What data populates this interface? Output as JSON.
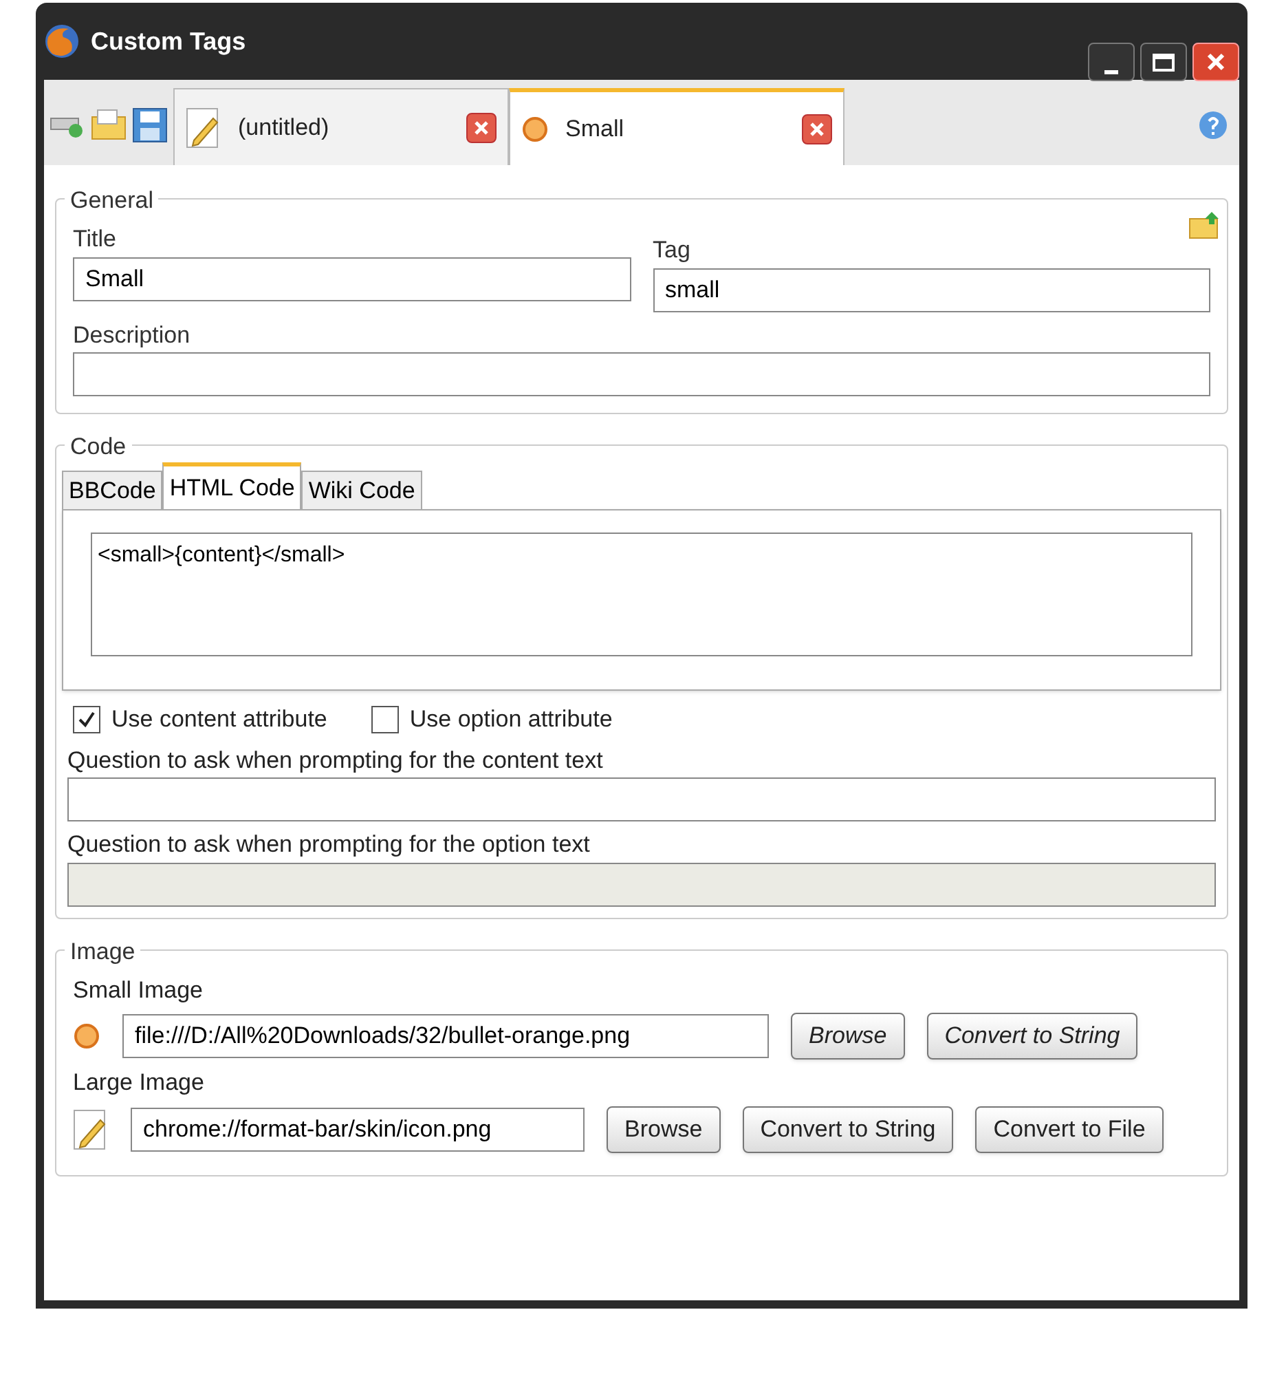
{
  "window": {
    "title": "Custom Tags"
  },
  "doc_tabs": [
    {
      "label": "(untitled)",
      "kind": "pencil",
      "selected": false
    },
    {
      "label": "Small",
      "kind": "bullet",
      "selected": true
    }
  ],
  "general": {
    "legend": "General",
    "title_label": "Title",
    "title_value": "Small",
    "tag_label": "Tag",
    "tag_value": "small",
    "description_label": "Description"
  },
  "code": {
    "legend": "Code",
    "tabs": [
      {
        "label": "BBCode",
        "selected": false
      },
      {
        "label": "HTML Code",
        "selected": true
      },
      {
        "label": "Wiki Code",
        "selected": false
      }
    ],
    "value": "<small>{content}</small>"
  },
  "options": [
    {
      "label": "Use content attribute",
      "checked": true
    },
    {
      "label": "Use option attribute",
      "checked": false
    }
  ],
  "questions": [
    {
      "label": "Question to ask when prompting for the content text",
      "disabled": false
    },
    {
      "label": "Question to ask when prompting for the option text",
      "disabled": true
    }
  ],
  "image": {
    "legend": "Image",
    "rows": [
      {
        "label": "Small Image",
        "kind": "bullet",
        "value": "file:///D:/All%20Downloads/32/bullet-orange.png",
        "buttons": [
          "Browse",
          "Convert to String"
        ],
        "italic": true
      },
      {
        "label": "Large Image",
        "kind": "pencil",
        "value": "chrome://format-bar/skin/icon.png",
        "buttons": [
          "Browse",
          "Convert to String",
          "Convert to File"
        ],
        "italic": false
      }
    ]
  }
}
